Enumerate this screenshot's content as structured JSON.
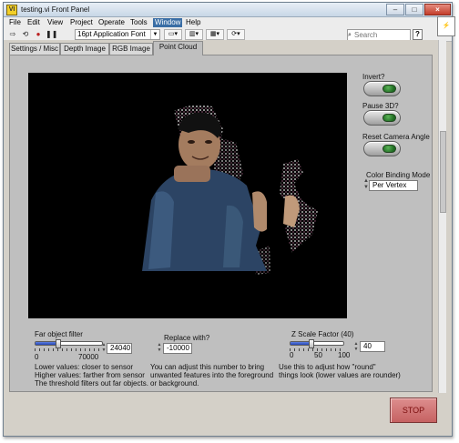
{
  "window": {
    "title": "testing.vi Front Panel",
    "icon_label": "VI"
  },
  "menu": {
    "items": [
      "File",
      "Edit",
      "View",
      "Project",
      "Operate",
      "Tools",
      "Window",
      "Help"
    ],
    "active": "Window"
  },
  "toolbar": {
    "font": "16pt Application Font",
    "search_placeholder": "Search",
    "buttons": [
      "run-arrow-icon",
      "run-continuously-icon",
      "abort-icon",
      "pause-icon"
    ]
  },
  "tabs": {
    "items": [
      "Settings / Misc",
      "Depth Image",
      "RGB Image",
      "Point Cloud"
    ],
    "selected": "Point Cloud"
  },
  "controls": {
    "invert": {
      "label": "Invert?"
    },
    "pause3d": {
      "label": "Pause 3D?"
    },
    "reset_camera": {
      "label": "Reset Camera Angle"
    },
    "color_binding": {
      "label": "Color Binding Mode",
      "value": "Per Vertex"
    },
    "far_filter": {
      "label": "Far object filter",
      "min": "0",
      "max": "70000",
      "value": "24040",
      "fill_fraction": 0.3434,
      "note": [
        "Lower values: closer to sensor",
        "Higher values: farther from sensor",
        "The threshold filters out far objects."
      ]
    },
    "replace_with": {
      "label": "Replace with?",
      "value": "-10000",
      "note": [
        "You can adjust this number to bring",
        "unwanted features into the foreground",
        "or background."
      ]
    },
    "z_scale": {
      "label": "Z Scale Factor (40)",
      "ticks": [
        "0",
        "50",
        "100"
      ],
      "value": "40",
      "fill_fraction": 0.4,
      "note": [
        "Use this to adjust how \"round\"",
        "things look (lower values are rounder)"
      ]
    },
    "stop": {
      "label": "STOP"
    }
  },
  "colors": {
    "accent": "#3a6ea5",
    "panel": "#bfbfbf",
    "stop": "#c66262",
    "led_on": "#2e8b35"
  }
}
